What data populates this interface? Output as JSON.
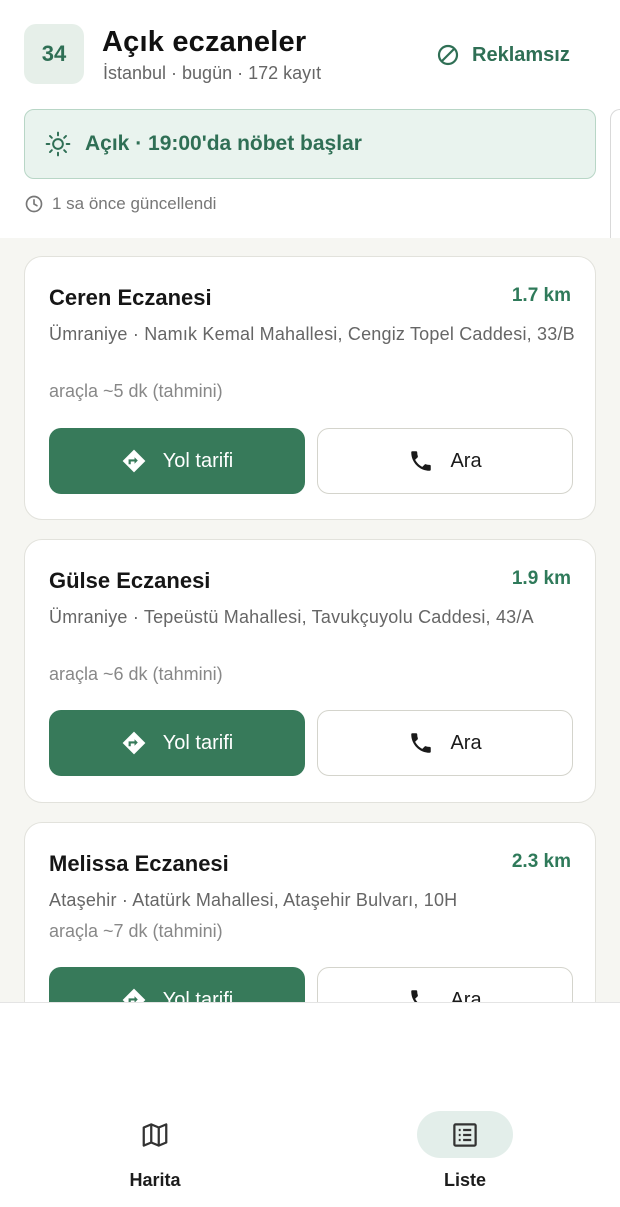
{
  "header": {
    "plate": "34",
    "title": "Açık eczaneler",
    "subtitle": "İstanbul · bugün · 172 kayıt",
    "adfree_label": "Reklamsız"
  },
  "status": {
    "text": "Açık · 19:00'da nöbet başlar"
  },
  "updated": {
    "text": "1 sa önce güncellendi"
  },
  "pharmacies": [
    {
      "name": "Ceren Eczanesi",
      "distance": "1.7 km",
      "address": "Ümraniye · Namık Kemal Mahallesi, Cengiz Topel Caddesi, 33/B",
      "eta": "araçla ~5 dk (tahmini)",
      "directions_label": "Yol tarifi",
      "call_label": "Ara"
    },
    {
      "name": "Gülse Eczanesi",
      "distance": "1.9 km",
      "address": "Ümraniye · Tepeüstü Mahallesi, Tavukçuyolu Caddesi, 43/A",
      "eta": "araçla ~6 dk (tahmini)",
      "directions_label": "Yol tarifi",
      "call_label": "Ara"
    },
    {
      "name": "Melissa Eczanesi",
      "distance": "2.3 km",
      "address": "Ataşehir · Atatürk Mahallesi, Ataşehir Bulvarı, 10H",
      "eta": "araçla ~7 dk (tahmini)",
      "directions_label": "Yol tarifi",
      "call_label": "Ara"
    }
  ],
  "nav": {
    "map_label": "Harita",
    "list_label": "Liste",
    "active": "list"
  },
  "colors": {
    "accent": "#377a5a",
    "accent_text": "#2f6f55",
    "status_bg": "#e9f3ee"
  },
  "icons": {
    "adfree": "block-icon",
    "status": "sun-icon",
    "updated": "clock-icon",
    "directions": "directions-icon",
    "call": "phone-icon",
    "map": "map-icon",
    "list": "list-icon"
  }
}
